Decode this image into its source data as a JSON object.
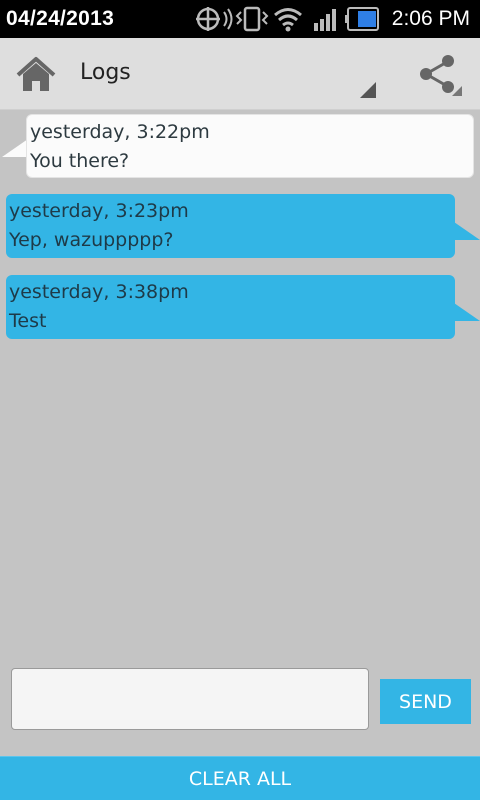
{
  "status_bar": {
    "date": "04/24/2013",
    "time": "2:06 PM",
    "icons": [
      "sync-icon",
      "vibrate-icon",
      "wifi-icon",
      "signal-icon",
      "battery-icon"
    ]
  },
  "action_bar": {
    "title": "Logs",
    "icons": [
      "home-icon",
      "share-icon"
    ]
  },
  "messages": [
    {
      "direction": "incoming",
      "time": "yesterday, 3:22pm",
      "text": "You there?"
    },
    {
      "direction": "outgoing",
      "time": "yesterday, 3:23pm",
      "text": "Yep, wazuppppp?"
    },
    {
      "direction": "outgoing",
      "time": "yesterday, 3:38pm",
      "text": "Test"
    }
  ],
  "composer": {
    "value": "",
    "send_label": "SEND"
  },
  "clear_all_label": "CLEAR ALL",
  "colors": {
    "accent": "#33b5e5",
    "background": "#c4c4c4",
    "actionbar": "#dedede",
    "incoming_bubble": "#fbfbfb"
  }
}
